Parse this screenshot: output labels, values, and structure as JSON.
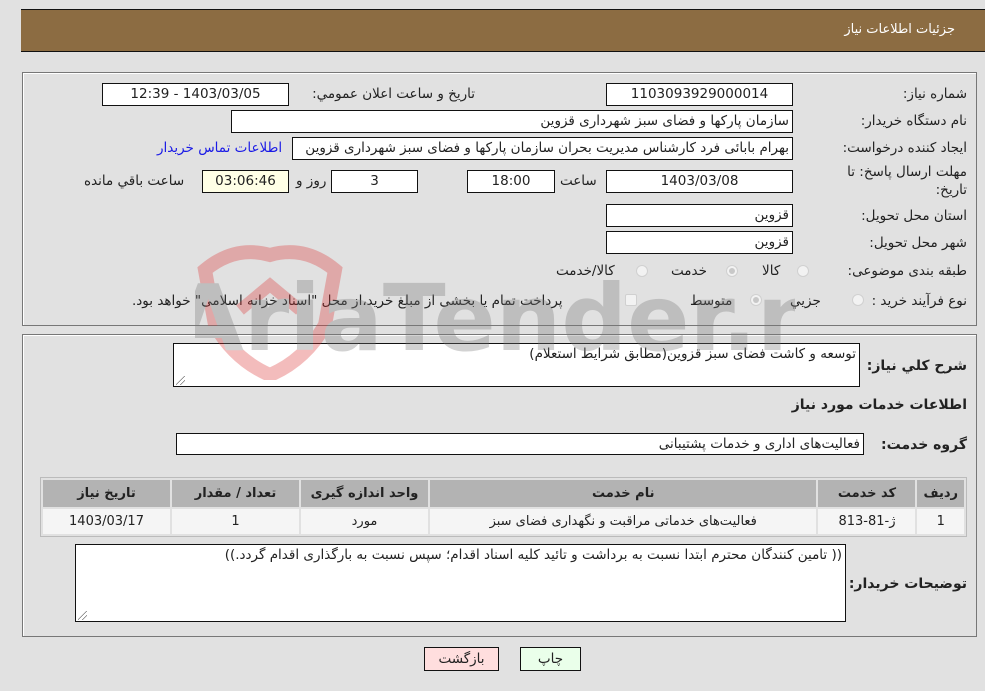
{
  "header": {
    "title": "جزئیات اطلاعات نیاز"
  },
  "info": {
    "need_number_label": "شماره نیاز:",
    "need_number": "1103093929000014",
    "announce_label": "تاریخ و ساعت اعلان عمومي:",
    "announce_value": "1403/03/05 - 12:39",
    "buyer_org_label": "نام دستگاه خريدار:",
    "buyer_org": "سازمان پارکها و فضای سبز شهرداری قزوین",
    "creator_label": "ایجاد کننده درخواست:",
    "creator": "بهرام بابائی فرد کارشناس مدیریت بحران سازمان پارکها و فضای سبز شهرداری قزوین",
    "contact_link": "اطلاعات تماس خریدار",
    "deadline_label_line1": "مهلت ارسال پاسخ: تا",
    "deadline_label_line2": "تاریخ:",
    "deadline_date": "1403/03/08",
    "time_label": "ساعت",
    "deadline_time": "18:00",
    "days_value": "3",
    "days_label": "روز و",
    "remaining_time": "03:06:46",
    "remaining_label": "ساعت باقي مانده",
    "province_label": "استان محل تحویل:",
    "province": "قزوین",
    "city_label": "شهر محل تحویل:",
    "city": "قزوین",
    "category_label": "طبقه بندی موضوعی:",
    "category_options": [
      {
        "label": "کالا",
        "selected": false
      },
      {
        "label": "خدمت",
        "selected": true
      },
      {
        "label": "کالا/خدمت",
        "selected": false
      }
    ],
    "process_label": "نوع فرآیند خرید :",
    "process_options": [
      {
        "label": "جزيي",
        "selected": false
      },
      {
        "label": "متوسط",
        "selected": true
      }
    ],
    "treasury_checkbox_label": "پرداخت تمام یا بخشی از مبلغ خرید،از محل \"اسناد خزانه اسلامی\" خواهد بود.",
    "treasury_checked": false
  },
  "details": {
    "description_label": "شرح کلي نياز:",
    "description": "توسعه و کاشت فضای سبز قزوین(مطابق شرایط استعلام)",
    "services_heading": "اطلاعات خدمات مورد نياز",
    "service_group_label": "گروه خدمت:",
    "service_group": "فعالیت‌های اداری و خدمات پشتیبانی",
    "table": {
      "headers": [
        "رديف",
        "کد خدمت",
        "نام خدمت",
        "واحد اندازه گیری",
        "تعداد / مقدار",
        "تاریخ نیاز"
      ],
      "rows": [
        [
          "1",
          "ژ-81-813",
          "فعالیت‌های خدماتی مراقبت و نگهداری فضای سبز",
          "مورد",
          "1",
          "1403/03/17"
        ]
      ]
    },
    "buyer_notes_label": "توضيحات خريدار:",
    "buyer_notes": "(( تامین کنندگان محترم ابتدا نسبت به برداشت و تائید کلیه اسناد اقدام؛ سپس نسبت به بارگذاری اقدام گردد.))"
  },
  "actions": {
    "print": "چاپ",
    "back": "بازگشت"
  },
  "watermark": {
    "text": "AriaTender.neT"
  },
  "colors": {
    "header_bg": "#8c6c42",
    "print_bg": "#eaffea",
    "back_bg": "#ffdede",
    "link": "#1a1ae6"
  }
}
